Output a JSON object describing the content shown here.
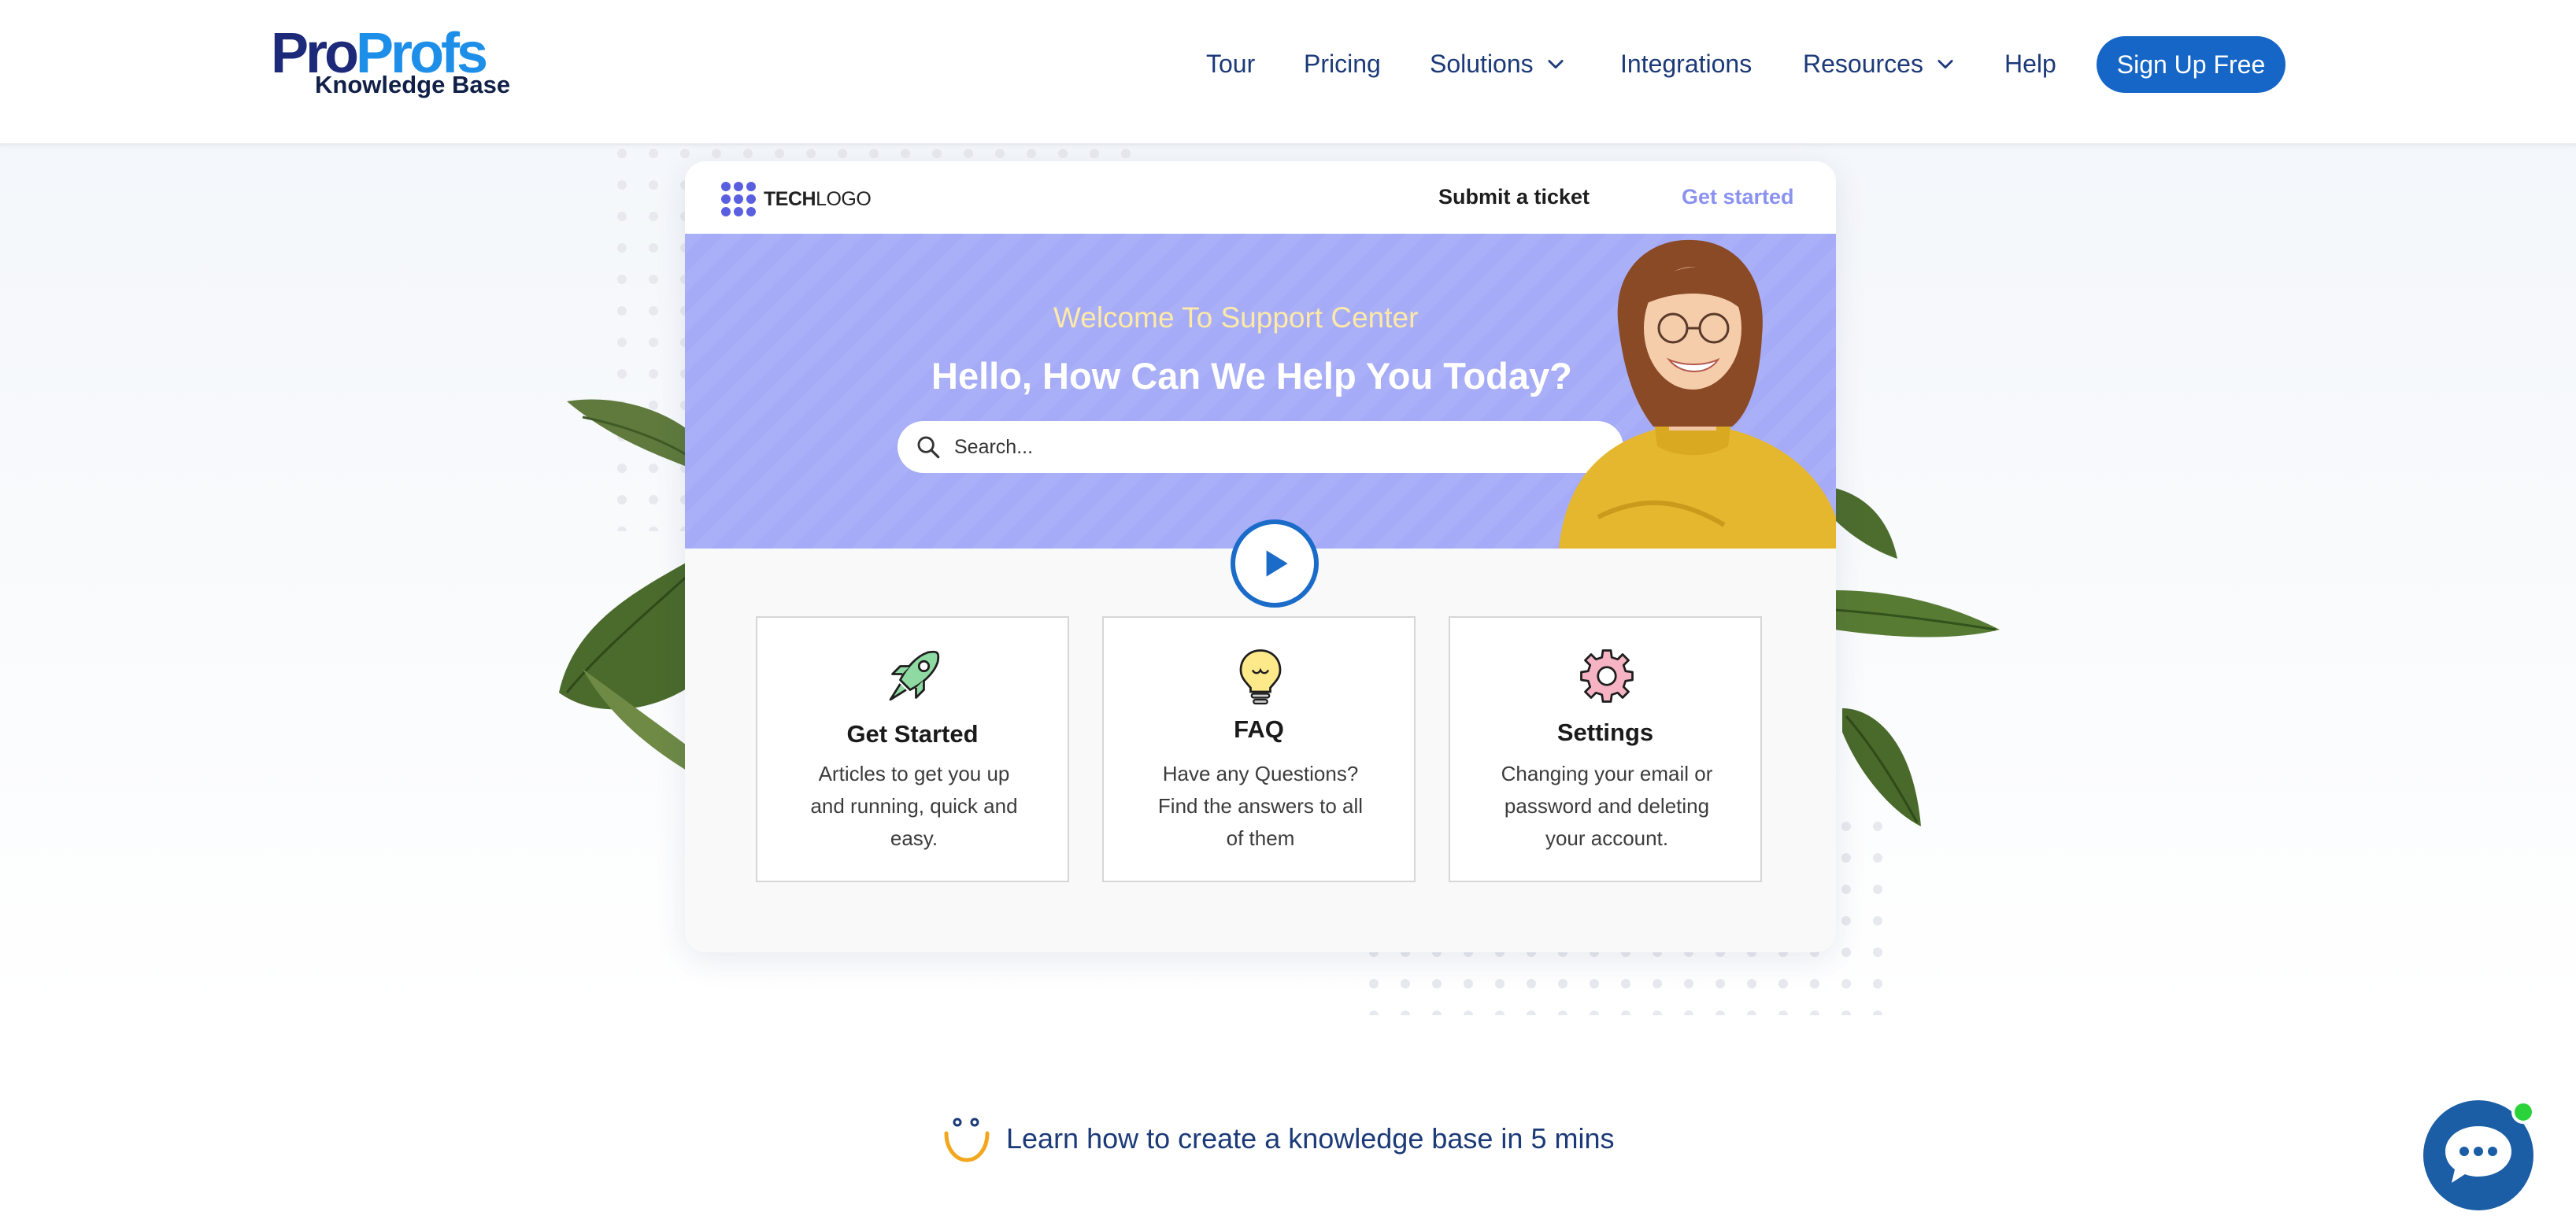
{
  "header": {
    "logo": {
      "brand_part1": "Pro",
      "brand_part2": "Profs",
      "sub": "Knowledge Base"
    },
    "nav": [
      {
        "label": "Tour"
      },
      {
        "label": "Pricing"
      },
      {
        "label": "Solutions",
        "dropdown": true
      },
      {
        "label": "Integrations"
      },
      {
        "label": "Resources",
        "dropdown": true
      },
      {
        "label": "Help"
      }
    ],
    "cta_label": "Sign Up Free"
  },
  "preview": {
    "techlogo_bold": "TECH",
    "techlogo_light": "LOGO",
    "submit_label": "Submit a ticket",
    "get_started_label": "Get started",
    "welcome_sub": "Welcome To Support Center",
    "welcome_title": "Hello, How Can We Help You Today?",
    "search_placeholder": "Search...",
    "features": [
      {
        "icon": "rocket-icon",
        "title": "Get Started",
        "desc": "Articles to get you up and running, quick and easy."
      },
      {
        "icon": "lightbulb-icon",
        "title": "FAQ",
        "desc": "Have any Questions? Find the answers to all of them"
      },
      {
        "icon": "gear-icon",
        "title": "Settings",
        "desc": "Changing your email or password and deleting your account."
      }
    ]
  },
  "learn_link": "Learn how to create a knowledge base in 5 mins",
  "colors": {
    "brand_dark": "#1d2a7a",
    "brand_blue": "#1e8fe8",
    "cta": "#1566c6",
    "banner": "#aab0f8",
    "nav_text": "#1c3a78",
    "chat": "#1b5ea6",
    "online": "#2bd33a"
  }
}
